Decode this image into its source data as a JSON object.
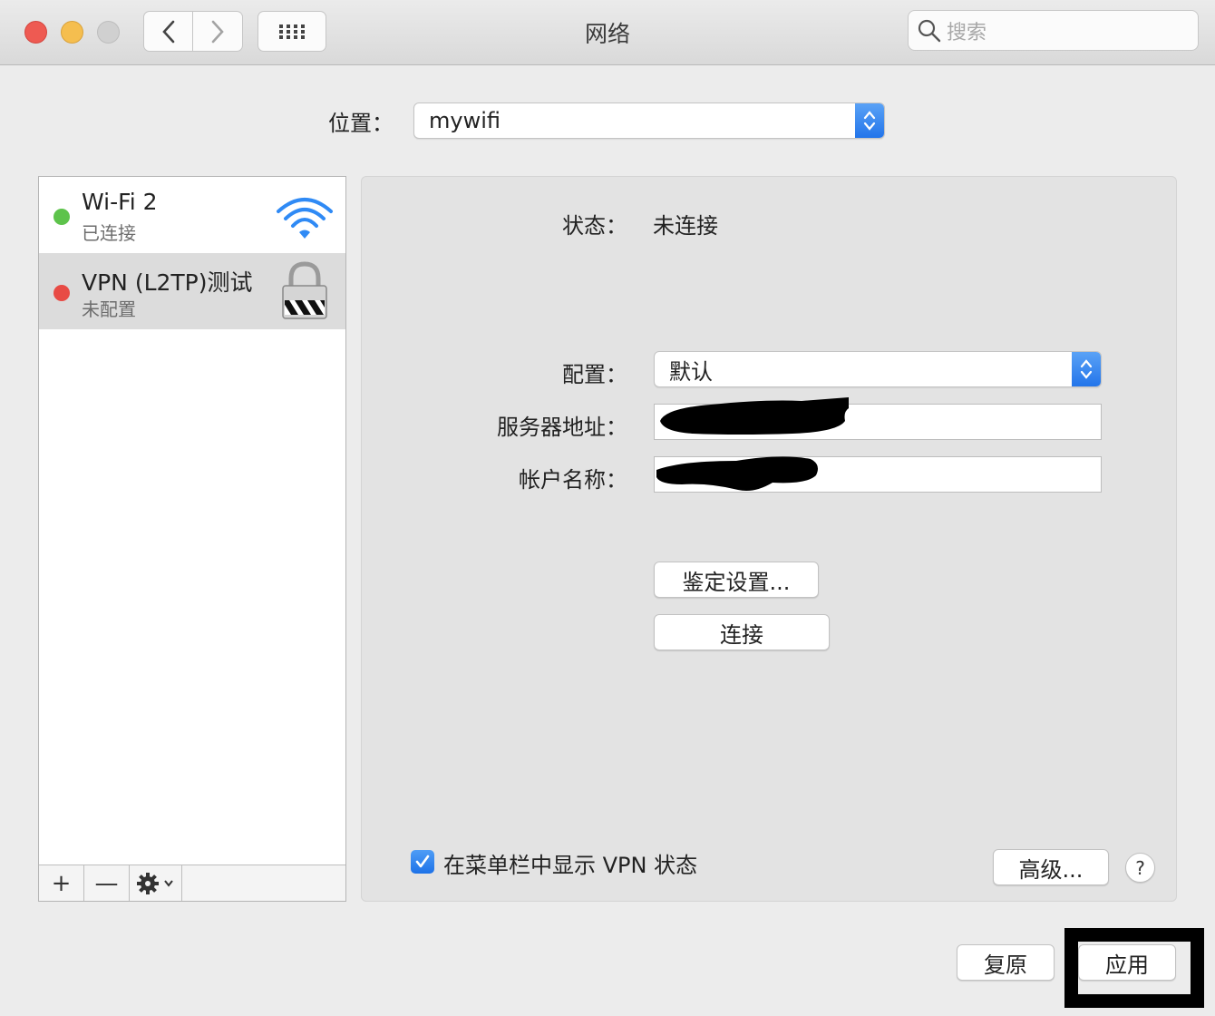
{
  "window": {
    "title": "网络"
  },
  "toolbar": {
    "back_icon": "chevron-left-icon",
    "forward_icon": "chevron-right-icon",
    "grid_icon": "grid-icon"
  },
  "search": {
    "placeholder": "搜索",
    "icon": "search-icon"
  },
  "location": {
    "label": "位置：",
    "value": "mywifi"
  },
  "sidebar": {
    "items": [
      {
        "name": "Wi-Fi 2",
        "status": "已连接",
        "dot_color": "#5dc34b",
        "icon": "wifi-icon",
        "selected": false
      },
      {
        "name": "VPN (L2TP)测试",
        "status": "未配置",
        "dot_color": "#e84b45",
        "icon": "vpn-lock-icon",
        "selected": true
      }
    ],
    "toolbar": {
      "add": "+",
      "remove": "—",
      "gear_icon": "gear-icon"
    }
  },
  "detail": {
    "status_label": "状态：",
    "status_value": "未连接",
    "config_label": "配置：",
    "config_value": "默认",
    "server_label": "服务器地址：",
    "server_value": "",
    "account_label": "帐户名称：",
    "account_value": "",
    "auth_button": "鉴定设置...",
    "connect_button": "连接",
    "show_vpn_checkbox": {
      "label": "在菜单栏中显示 VPN 状态",
      "checked": true
    },
    "advanced_button": "高级...",
    "help_button": "?"
  },
  "footer": {
    "revert_button": "复原",
    "apply_button": "应用"
  },
  "colors": {
    "accent": "#2375ea",
    "window_bg": "#ececec",
    "panel_bg": "#e3e3e3"
  }
}
